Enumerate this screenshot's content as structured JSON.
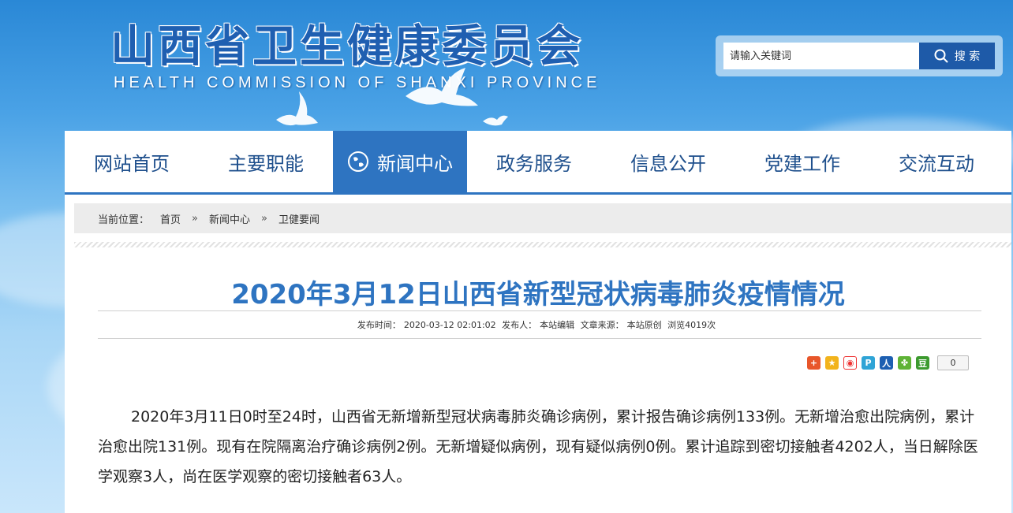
{
  "header": {
    "site_title": "山西省卫生健康委员会",
    "site_subtitle": "HEALTH COMMISSION OF SHANXI PROVINCE"
  },
  "search": {
    "placeholder": "请输入关键词",
    "button_label": "搜 索",
    "button_icon": "search-icon"
  },
  "nav": {
    "items": [
      {
        "label": "网站首页",
        "active": false
      },
      {
        "label": "主要职能",
        "active": false
      },
      {
        "label": "新闻中心",
        "active": true,
        "icon": "globe-icon"
      },
      {
        "label": "政务服务",
        "active": false
      },
      {
        "label": "信息公开",
        "active": false
      },
      {
        "label": "党建工作",
        "active": false
      },
      {
        "label": "交流互动",
        "active": false
      }
    ]
  },
  "breadcrumb": {
    "prefix": "当前位置：",
    "items": [
      "首页",
      "新闻中心",
      "卫健要闻"
    ],
    "separator": "»"
  },
  "article": {
    "title": "2020年3月12日山西省新型冠状病毒肺炎疫情情况",
    "meta": {
      "published_label": "发布时间：",
      "published_value": "2020-03-12 02:01:02",
      "publisher_label": "发布人：",
      "publisher_value": "本站编辑",
      "source_label": "文章来源：",
      "source_value": "本站原创",
      "views": "浏览4019次"
    },
    "share": {
      "icons": [
        "plus-share-icon",
        "qzone-icon",
        "weibo-icon",
        "tencent-weibo-icon",
        "renren-icon",
        "kaixin-icon",
        "douban-icon"
      ],
      "count": "0"
    },
    "body": "2020年3月11日0时至24时，山西省无新增新型冠状病毒肺炎确诊病例，累计报告确诊病例133例。无新增治愈出院病例，累计治愈出院131例。现有在院隔离治疗确诊病例2例。无新增疑似病例，现有疑似病例0例。累计追踪到密切接触者4202人，当日解除医学观察3人，尚在医学观察的密切接触者63人。"
  },
  "colors": {
    "brand_blue": "#2e74c1",
    "dark_blue": "#1e5aa8",
    "title_blue": "#1f5fb1"
  }
}
